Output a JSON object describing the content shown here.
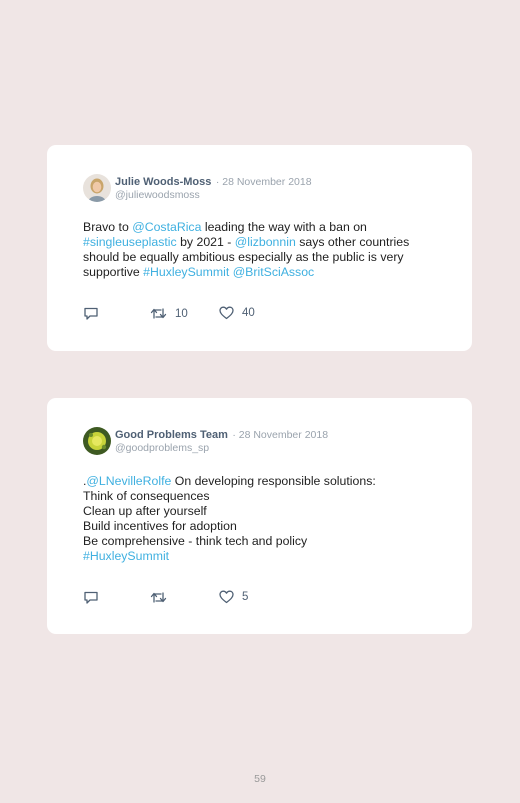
{
  "tweets": [
    {
      "author": "Julie Woods-Moss",
      "date": "· 28 November 2018",
      "handle": "@juliewoodsmoss",
      "text": {
        "l1a": "Bravo to ",
        "l1b": "@CostaRica",
        "l1c": " leading the way with a ban on",
        "l2a": "#singleuseplastic",
        "l2b": " by 2021 - ",
        "l2c": "@lizbonnin",
        "l2d": " says other countries",
        "l3": "should be equally ambitious especially as the public is very",
        "l4a": "supportive ",
        "l4b": "#HuxleySummit",
        "l4c": " ",
        "l4d": "@BritSciAssoc"
      },
      "retweets": "10",
      "likes": "40"
    },
    {
      "author": "Good Problems Team",
      "date": "· 28 November 2018",
      "handle": "@goodproblems_sp",
      "text": {
        "l1a": ".",
        "l1b": "@LNevilleRolfe",
        "l1c": " On developing responsible solutions:",
        "l2": "Think of consequences",
        "l3": "Clean up after yourself",
        "l4": "Build incentives for adoption",
        "l5": "Be comprehensive - think tech and policy",
        "l6": "#HuxleySummit"
      },
      "retweets": "",
      "likes": "5"
    }
  ],
  "page_number": "59",
  "colors": {
    "link": "#3fb0e0",
    "name": "#4f6074",
    "muted": "#9aa3ad",
    "background": "#f0e6e6"
  },
  "icons": [
    "reply-icon",
    "retweet-icon",
    "heart-icon"
  ]
}
